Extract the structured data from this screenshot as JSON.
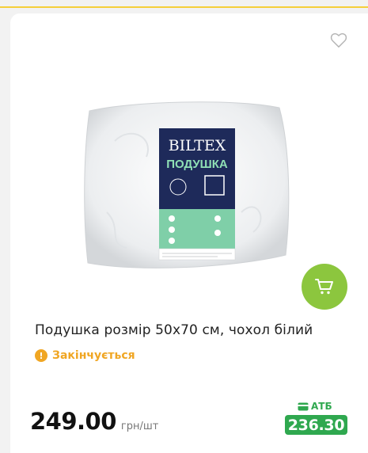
{
  "product": {
    "title": "Подушка розмір 50х70 см, чохол білий",
    "status": "Закінчується",
    "price": "249.00",
    "price_unit": "грн/шт",
    "store_label": "АТБ",
    "store_price": "236.30"
  },
  "package": {
    "brand": "BILTEX",
    "name": "ПОДУШКА"
  },
  "icons": {
    "favorite": "heart-outline-icon",
    "cart": "cart-icon",
    "status": "warning-icon",
    "store": "card-icon"
  },
  "colors": {
    "accent_green": "#8cc63e",
    "store_green": "#2fa84f",
    "warning": "#f0a623",
    "package_navy": "#1e2a5a",
    "package_mint": "#7fcfa8"
  }
}
